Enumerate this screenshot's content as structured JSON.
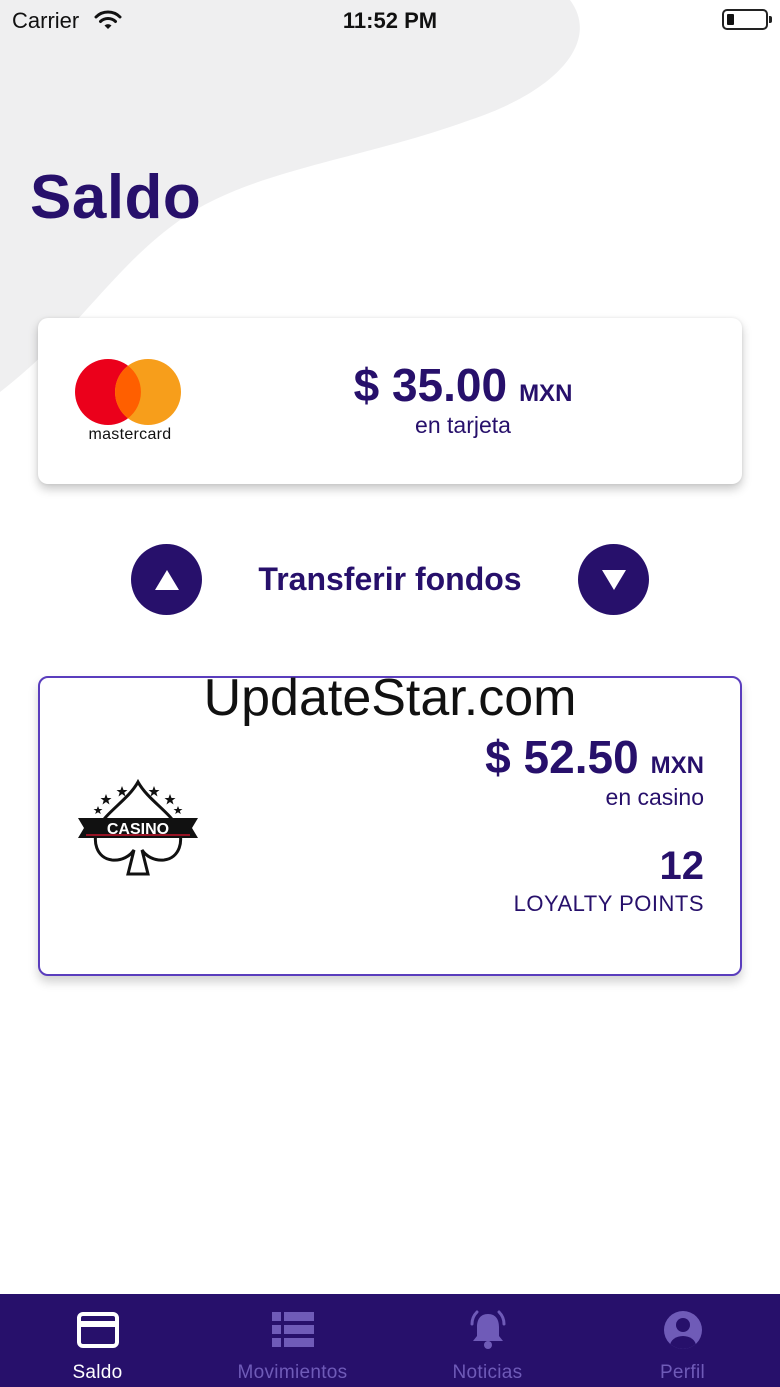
{
  "status_bar": {
    "carrier": "Carrier",
    "time": "11:52 PM"
  },
  "page": {
    "title": "Saldo"
  },
  "card_balance": {
    "brand_wordmark": "mastercard",
    "amount": "$ 35.00",
    "currency": "MXN",
    "caption": "en tarjeta",
    "logo_colors": {
      "red": "#eb001b",
      "orange": "#f79e1b",
      "overlap": "#ff5f00"
    }
  },
  "transfer": {
    "label": "Transferir fondos",
    "up_icon": "triangle-up-icon",
    "down_icon": "triangle-down-icon"
  },
  "casino_balance": {
    "logo_text": "CASINO",
    "amount": "$ 52.50",
    "currency": "MXN",
    "caption": "en casino",
    "points_value": "12",
    "points_label": "LOYALTY POINTS"
  },
  "watermark": "UpdateStar.com",
  "tab_bar": {
    "items": [
      {
        "label": "Saldo",
        "icon": "credit-card-icon",
        "active": true
      },
      {
        "label": "Movimientos",
        "icon": "list-icon",
        "active": false
      },
      {
        "label": "Noticias",
        "icon": "bell-icon",
        "active": false
      },
      {
        "label": "Perfil",
        "icon": "user-icon",
        "active": false
      }
    ]
  },
  "colors": {
    "primary": "#27106b",
    "tab_inactive": "#6f5bb8",
    "card_border": "#5a3dbd",
    "background_blob": "#efeff0"
  }
}
